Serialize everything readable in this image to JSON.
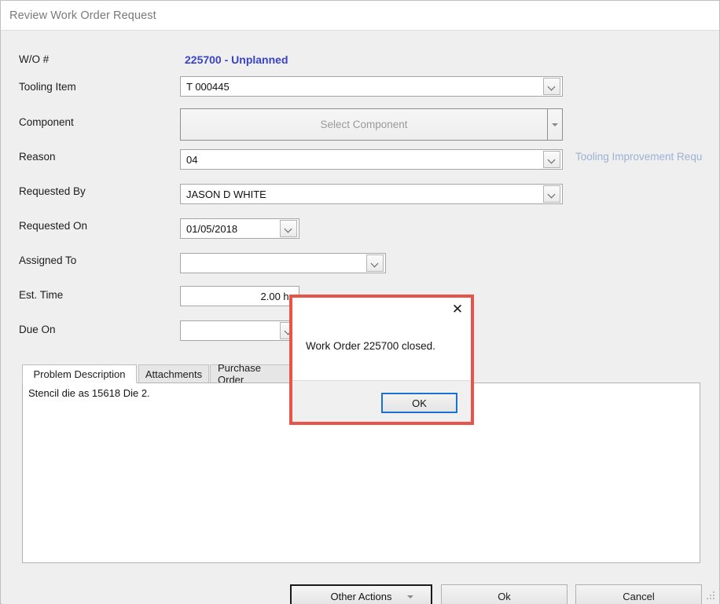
{
  "window": {
    "title": "Review Work Order Request"
  },
  "form": {
    "labels": {
      "wo_number": "W/O #",
      "tooling_item": "Tooling Item",
      "component": "Component",
      "reason": "Reason",
      "requested_by": "Requested By",
      "requested_on": "Requested On",
      "assigned_to": "Assigned To",
      "est_time": "Est. Time",
      "due_on": "Due On"
    },
    "values": {
      "wo_number": "225700 - Unplanned",
      "tooling_item": "T 000445",
      "component_placeholder": "Select Component",
      "reason": "04",
      "reason_description": "Tooling Improvement Requ",
      "requested_by": "JASON D WHITE",
      "requested_on": "01/05/2018",
      "assigned_to": "",
      "est_time": "2.00 hr",
      "due_on": ""
    }
  },
  "tabs": [
    {
      "label": "Problem Description",
      "active": true
    },
    {
      "label": "Attachments",
      "active": false
    },
    {
      "label": "Purchase Order",
      "active": false
    }
  ],
  "description": {
    "text": "Stencil die as 15618 Die 2."
  },
  "footer": {
    "other_actions": "Other Actions",
    "ok": "Ok",
    "cancel": "Cancel"
  },
  "dialog": {
    "message": "Work Order 225700 closed.",
    "ok_label": "OK",
    "close_glyph": "✕",
    "border_color": "#e8534a",
    "ok_focus_color": "#1b72d0"
  },
  "colors": {
    "wo_accent": "#3a43c8",
    "reason_desc": "#9bb2d4",
    "window_bg": "#efefef",
    "titlebar_bg": "#ffffff"
  }
}
